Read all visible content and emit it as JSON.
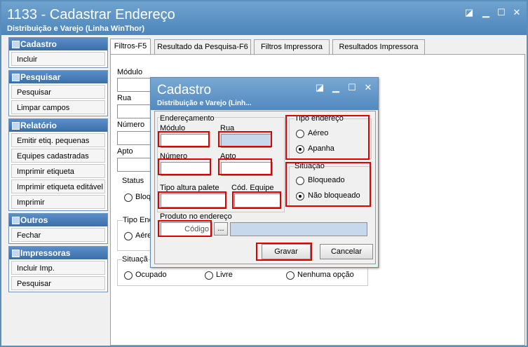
{
  "window": {
    "title": "1133 - Cadastrar Endereço",
    "subtitle": "Distribuição e Varejo (Linha WinThor)"
  },
  "sidebar": {
    "groups": [
      {
        "title": "Cadastro",
        "items": [
          "Incluir"
        ]
      },
      {
        "title": "Pesquisar",
        "items": [
          "Pesquisar",
          "Limpar campos"
        ]
      },
      {
        "title": "Relatório",
        "items": [
          "Emitir etiq. pequenas",
          "Equipes cadastradas",
          "Imprimir etiqueta",
          "Imprimir etiqueta editável",
          "Imprimir"
        ]
      },
      {
        "title": "Outros",
        "items": [
          "Fechar"
        ]
      },
      {
        "title": "Impressoras",
        "items": [
          "Incluir Imp.",
          "Pesquisar"
        ]
      }
    ]
  },
  "tabs": [
    "Filtros-F5",
    "Resultado da Pesquisa-F6",
    "Filtros Impressora",
    "Resultados Impressora"
  ],
  "filters": {
    "modulo": "Módulo",
    "rua": "Rua",
    "numero": "Número",
    "apto": "Apto",
    "status": "Status",
    "status_opt": "Bloqu",
    "tipo_end": "Tipo End",
    "tipo_opt": "Aére",
    "situacao": "Situaçã",
    "situacao_opts": [
      "Ocupado",
      "Livre",
      "Nenhuma opção"
    ]
  },
  "dialog": {
    "title": "Cadastro",
    "subtitle": "Distribuição e Varejo (Linh...",
    "enderecamento": "Endereçamento",
    "modulo": "Módulo",
    "rua": "Rua",
    "numero": "Número",
    "apto": "Apto",
    "tipo_altura": "Tipo altura palete",
    "cod_equipe": "Cód. Equipe",
    "produto": "Produto no endereço",
    "codigo_placeholder": "Código",
    "browse": "...",
    "tipo_endereco": "Tipo endereço",
    "tipo_opts": [
      "Aéreo",
      "Apanha"
    ],
    "situacao": "Situação",
    "situacao_opts": [
      "Bloqueado",
      "Não bloqueado"
    ],
    "gravar": "Gravar",
    "cancelar": "Cancelar"
  }
}
